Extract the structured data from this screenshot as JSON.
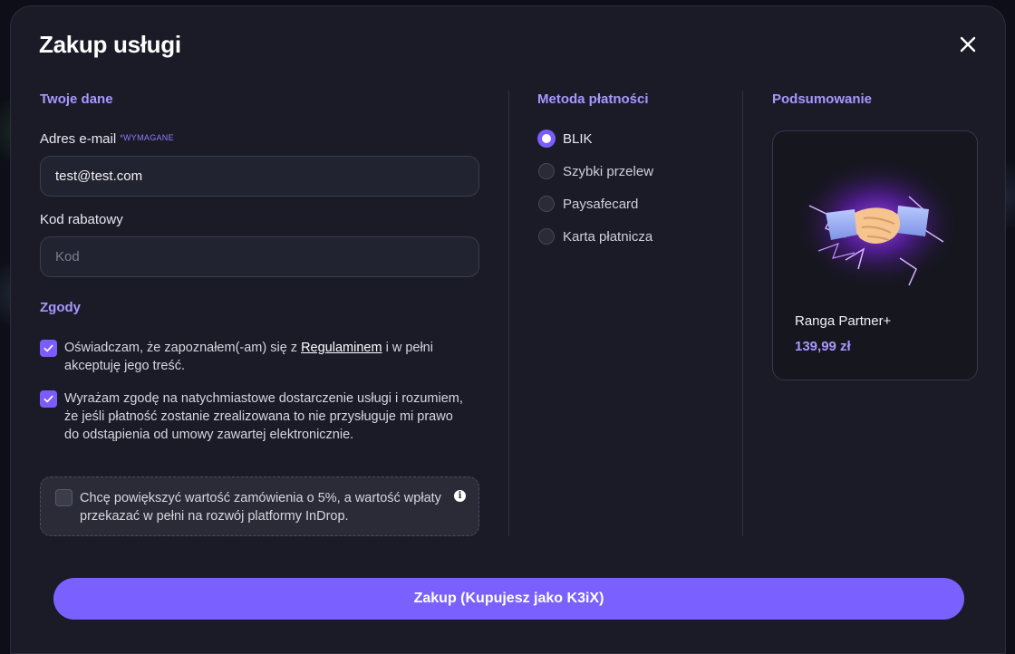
{
  "modal": {
    "title": "Zakup usługi"
  },
  "your_data": {
    "heading": "Twoje dane",
    "email_label": "Adres e-mail",
    "email_required": "*WYMAGANE",
    "email_value": "test@test.com",
    "discount_label": "Kod rabatowy",
    "discount_placeholder": "Kod"
  },
  "consents": {
    "heading": "Zgody",
    "terms_prefix": "Oświadczam, że zapoznałem(-am) się z ",
    "terms_link": "Regulaminem",
    "terms_suffix": " i w pełni akceptuję jego treść.",
    "terms_checked": true,
    "delivery_text": "Wyrażam zgodę na natychmiastowe dostarczenie usługi i rozumiem, że jeśli płatność zostanie zrealizowana to nie przysługuje mi prawo do odstąpienia od umowy zawartej elektronicznie.",
    "delivery_checked": true,
    "donate_text": "Chcę powiększyć wartość zamówienia o 5%, a wartość wpłaty przekazać w pełni na rozwój platformy InDrop.",
    "donate_checked": false,
    "info_glyph": "i"
  },
  "payment": {
    "heading": "Metoda płatności",
    "methods": [
      "BLIK",
      "Szybki przelew",
      "Paysafecard",
      "Karta płatnicza"
    ],
    "selected": "BLIK"
  },
  "summary": {
    "heading": "Podsumowanie",
    "product_name": "Ranga Partner+",
    "product_price": "139,99 zł"
  },
  "actions": {
    "buy_label": "Zakup (Kupujesz jako K3iX)"
  },
  "colors": {
    "accent": "#7a61ff",
    "accent_text": "#a996ff",
    "panel": "#1a1b27"
  },
  "icons": {
    "close": "close-icon",
    "check": "check-icon",
    "info": "info-icon",
    "product": "handshake-icon"
  }
}
